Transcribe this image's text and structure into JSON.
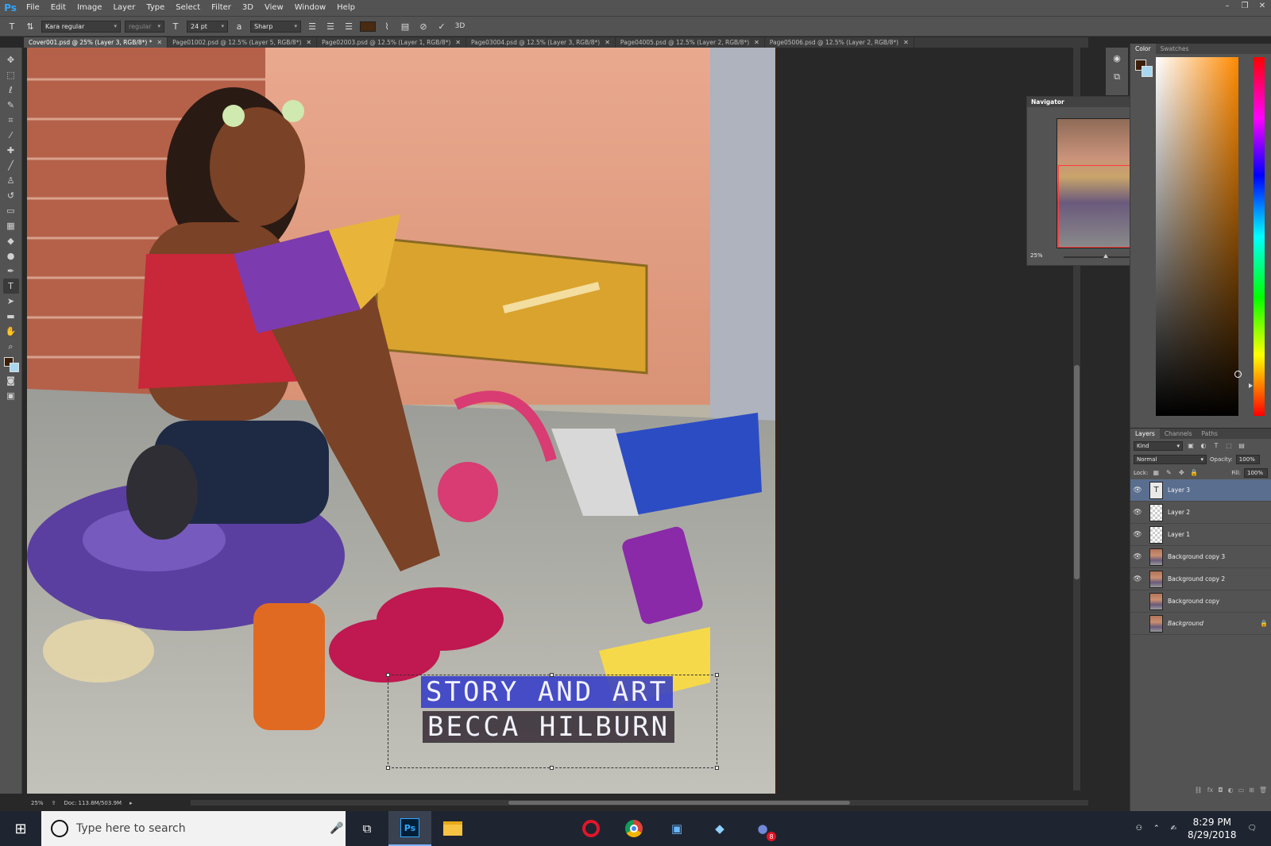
{
  "app": {
    "logo": "Ps"
  },
  "menu": [
    "File",
    "Edit",
    "Image",
    "Layer",
    "Type",
    "Select",
    "Filter",
    "3D",
    "View",
    "Window",
    "Help"
  ],
  "window_controls": [
    "–",
    "❐",
    "✕"
  ],
  "options": {
    "font_family": "Kara regular",
    "font_style": "regular",
    "font_size": "24 pt",
    "antialias": "Sharp",
    "text_color": "#4a2a10",
    "mode_3d": "3D"
  },
  "tabs": [
    {
      "label": "Cover001.psd @ 25% (Layer 3, RGB/8*) *",
      "active": true
    },
    {
      "label": "Page01002.psd @ 12.5% (Layer 5, RGB/8*)"
    },
    {
      "label": "Page02003.psd @ 12.5% (Layer 1, RGB/8*)"
    },
    {
      "label": "Page03004.psd @ 12.5% (Layer 3, RGB/8*)"
    },
    {
      "label": "Page04005.psd @ 12.5% (Layer 2, RGB/8*)"
    },
    {
      "label": "Page05006.psd @ 12.5% (Layer 2, RGB/8*)"
    }
  ],
  "artwork": {
    "line1": "STORY AND ART",
    "line2": "BECCA HILBURN"
  },
  "status": {
    "zoom": "25%",
    "doc": "Doc: 113.8M/503.9M"
  },
  "navigator": {
    "title": "Navigator",
    "zoom": "25%"
  },
  "color_panel": {
    "tabs": [
      "Color",
      "Swatches"
    ],
    "foreground": "#3b1f0a",
    "background": "#a8d8f0"
  },
  "layers_panel": {
    "tabs": [
      "Layers",
      "Channels",
      "Paths"
    ],
    "kind": "Kind",
    "blend": "Normal",
    "opacity_label": "Opacity:",
    "opacity": "100%",
    "lock_label": "Lock:",
    "fill_label": "Fill:",
    "fill": "100%",
    "layers": [
      {
        "name": "Layer 3",
        "kind": "text",
        "visible": true,
        "selected": true
      },
      {
        "name": "Layer 2",
        "kind": "trans",
        "visible": true
      },
      {
        "name": "Layer 1",
        "kind": "trans",
        "visible": true
      },
      {
        "name": "Background copy 3",
        "kind": "img",
        "visible": true
      },
      {
        "name": "Background copy 2",
        "kind": "img",
        "visible": true
      },
      {
        "name": "Background copy",
        "kind": "img",
        "visible": false
      },
      {
        "name": "Background",
        "kind": "img",
        "visible": false,
        "italic": true,
        "locked": true
      }
    ]
  },
  "taskbar": {
    "search_placeholder": "Type here to search",
    "time": "8:29 PM",
    "date": "8/29/2018",
    "mail_badge": "8"
  }
}
